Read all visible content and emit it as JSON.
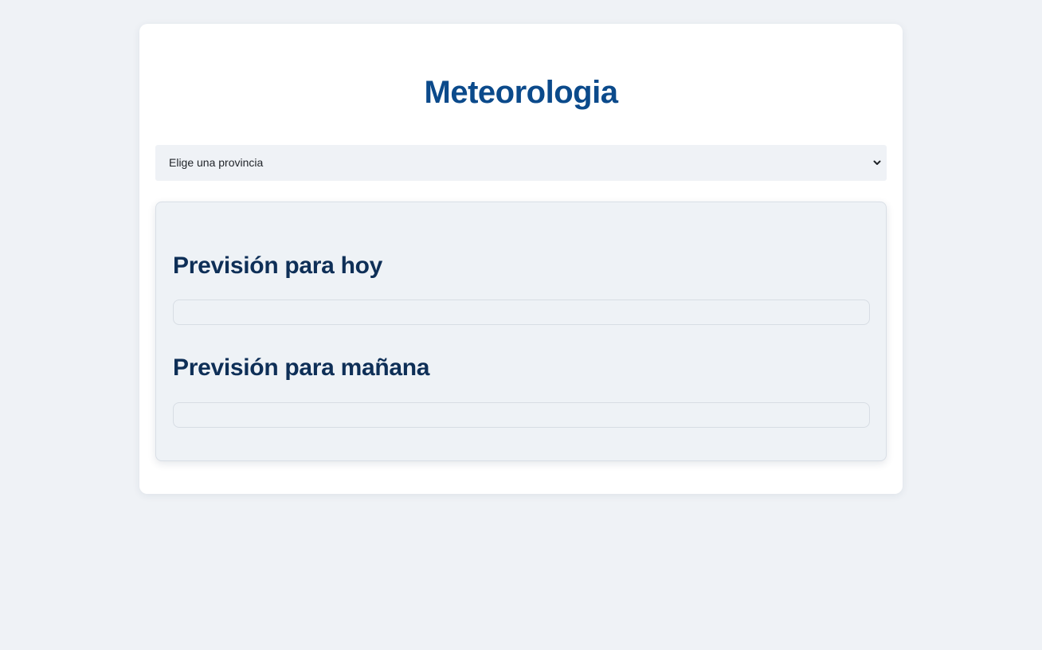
{
  "page": {
    "title": "Meteorologia"
  },
  "province_select": {
    "selected": "Elige una provincia"
  },
  "forecast": {
    "today_title": "Previsión para hoy",
    "today_content": "",
    "tomorrow_title": "Previsión para mañana",
    "tomorrow_content": ""
  },
  "colors": {
    "background": "#eff2f6",
    "card": "#ffffff",
    "title": "#0b4a8b",
    "section_title": "#0e2f57"
  },
  "icons": {
    "select_arrow": "chevron-down-icon"
  }
}
